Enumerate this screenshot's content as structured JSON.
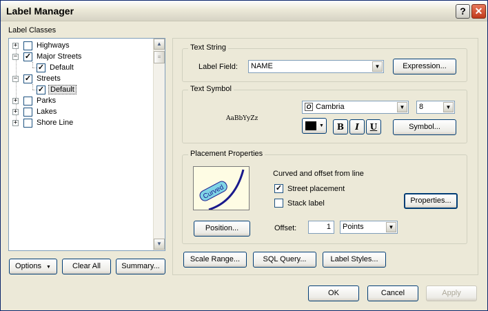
{
  "window": {
    "title": "Label Manager"
  },
  "titlebar": {
    "help": "?",
    "close": "✕"
  },
  "label_classes": {
    "heading": "Label Classes",
    "items": [
      {
        "label": "Highways",
        "expander": "+",
        "checked": false
      },
      {
        "label": "Major Streets",
        "expander": "−",
        "checked": true
      },
      {
        "label": "Default",
        "child": true,
        "checked": true
      },
      {
        "label": "Streets",
        "expander": "−",
        "checked": true
      },
      {
        "label": "Default",
        "child": true,
        "checked": true,
        "selected": true
      },
      {
        "label": "Parks",
        "expander": "+",
        "checked": false
      },
      {
        "label": "Lakes",
        "expander": "+",
        "checked": false
      },
      {
        "label": "Shore Line",
        "expander": "+",
        "checked": false
      }
    ]
  },
  "left_buttons": {
    "options": "Options",
    "clear_all": "Clear All",
    "summary": "Summary..."
  },
  "text_string": {
    "group": "Text String",
    "label_field_label": "Label Field:",
    "label_field_value": "NAME",
    "expression": "Expression..."
  },
  "text_symbol": {
    "group": "Text Symbol",
    "preview": "AaBbYyZz",
    "font": "Cambria",
    "size": "8",
    "bold": "B",
    "italic": "I",
    "underline": "U",
    "symbol": "Symbol...",
    "color": "#000000"
  },
  "placement": {
    "group": "Placement Properties",
    "preview_text": "Curved",
    "description": "Curved and offset from line",
    "street_placement": "Street placement",
    "stack_label": "Stack label",
    "properties": "Properties...",
    "position": "Position...",
    "offset_label": "Offset:",
    "offset_value": "1",
    "units": "Points"
  },
  "bottom_row": {
    "scale_range": "Scale Range...",
    "sql_query": "SQL Query...",
    "label_styles": "Label Styles..."
  },
  "dialog": {
    "ok": "OK",
    "cancel": "Cancel",
    "apply": "Apply"
  }
}
